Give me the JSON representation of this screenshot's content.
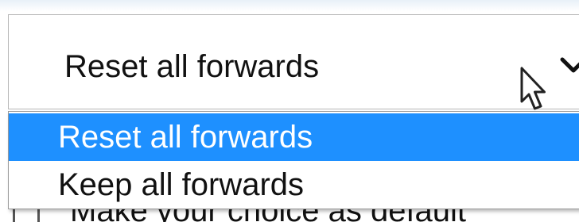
{
  "select": {
    "current_value": "Reset all forwards",
    "options": [
      {
        "label": "Reset all forwards",
        "selected": true
      },
      {
        "label": "Keep all forwards",
        "selected": false
      }
    ]
  },
  "background": {
    "default_checkbox_label": "Make your choice as default"
  },
  "colors": {
    "highlight": "#1e90ff",
    "text": "#111111",
    "border": "#b7b7b7"
  },
  "icons": {
    "chevron": "chevron-down-icon",
    "cursor": "mouse-pointer-icon"
  }
}
